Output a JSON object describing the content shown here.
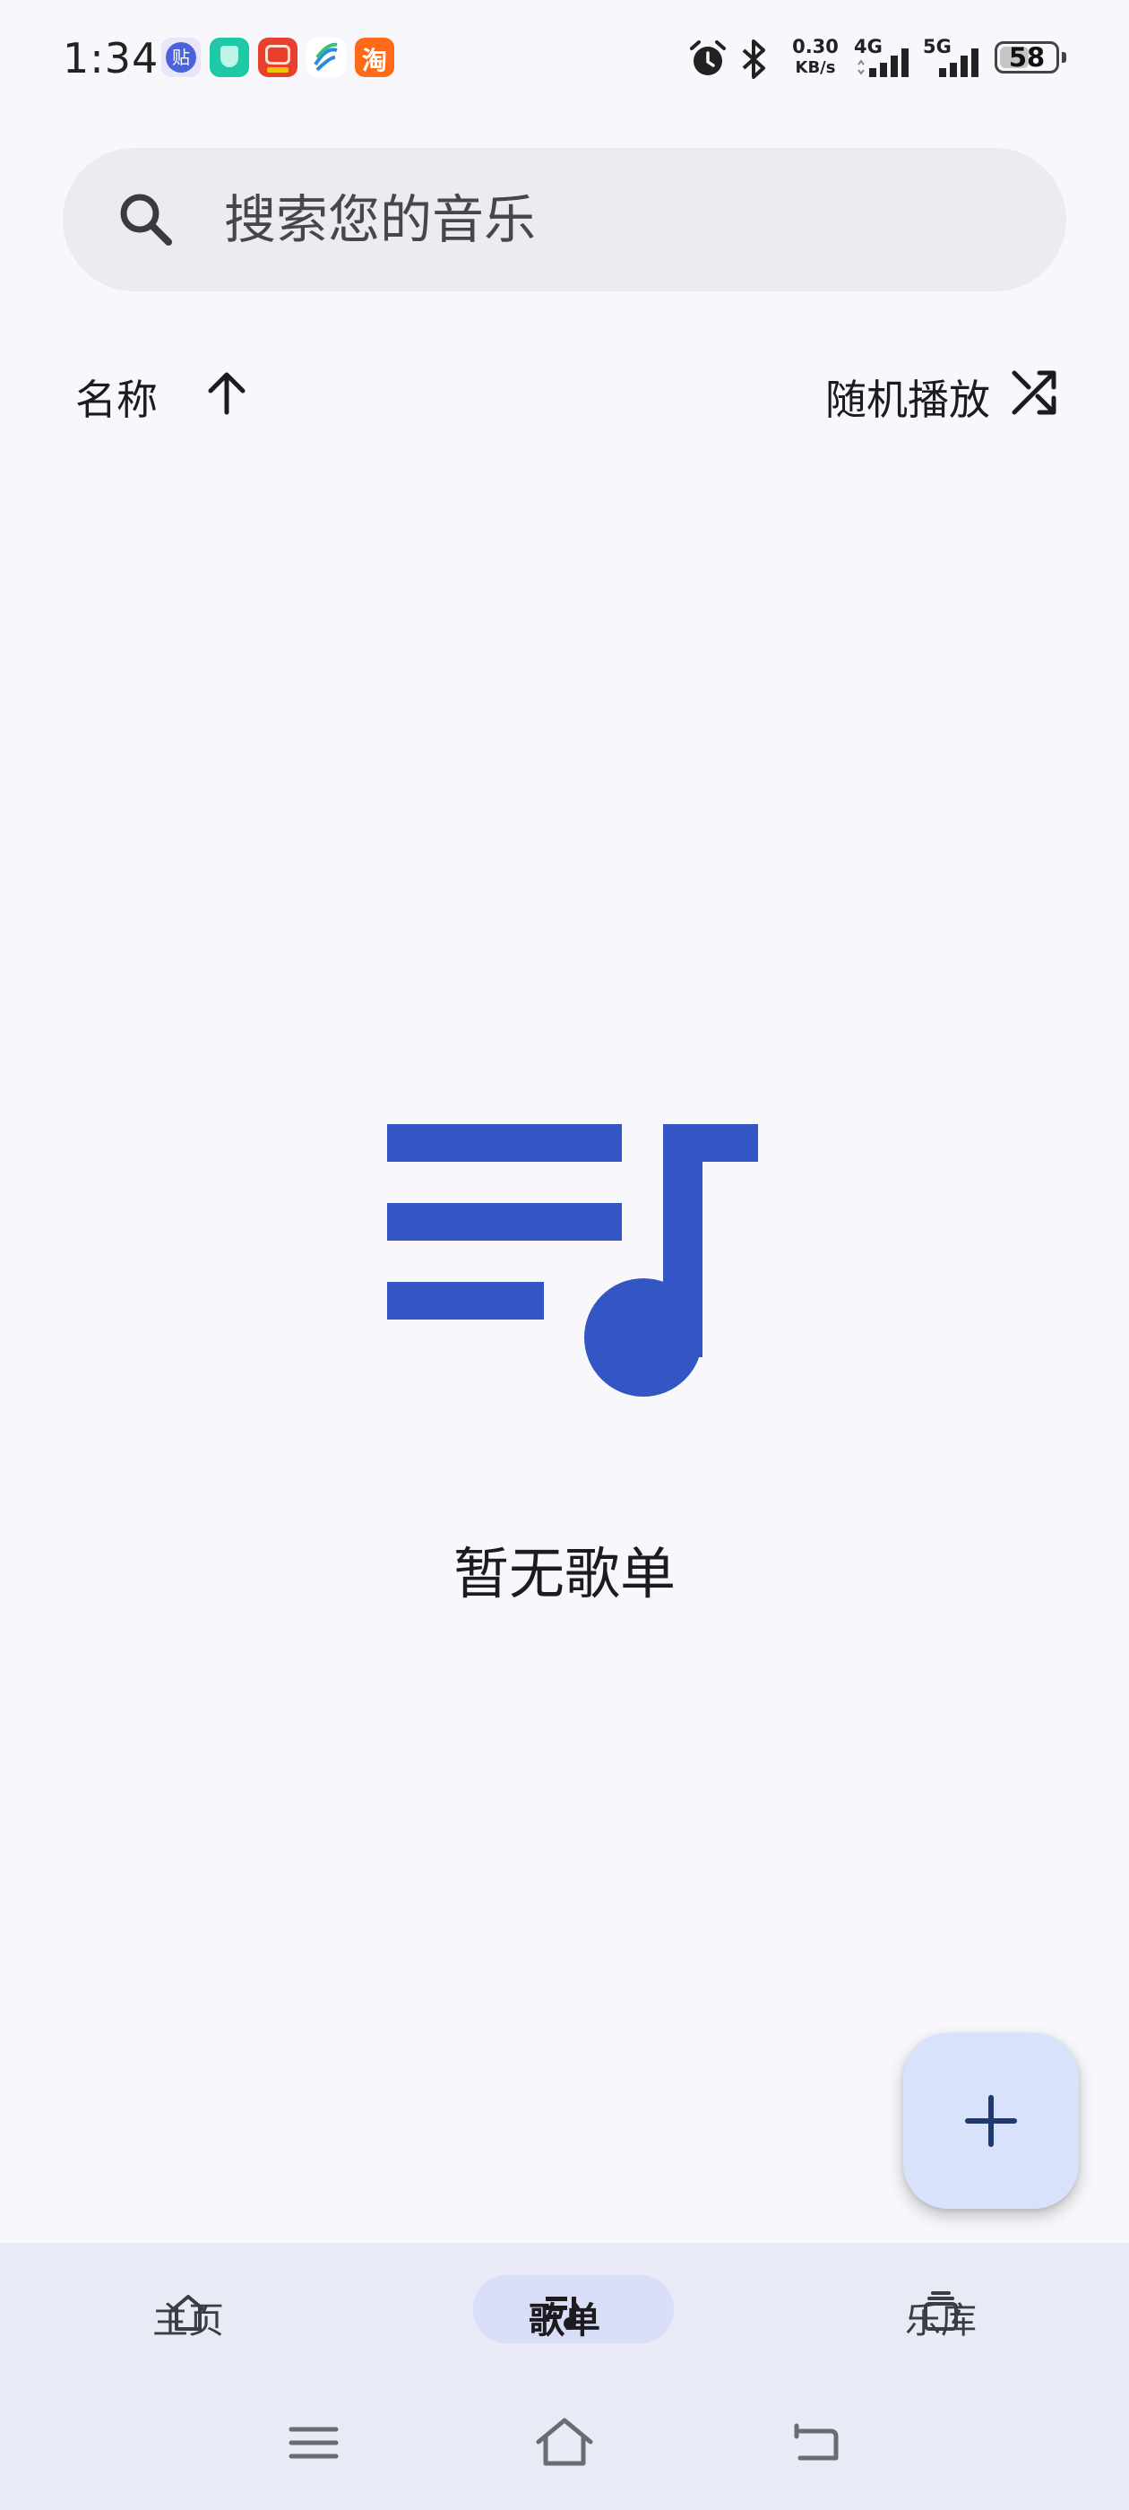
{
  "status_bar": {
    "time": "1:34",
    "notification_icons": [
      {
        "name": "tieba-app-icon",
        "color": "#4b63d8",
        "glyph": "贴"
      },
      {
        "name": "security-app-icon",
        "color": "#1ec9a8",
        "glyph": ""
      },
      {
        "name": "red-app-icon",
        "color": "#e8402d",
        "glyph": ""
      },
      {
        "name": "mobile-app-icon",
        "color": "#ffffff",
        "glyph": ""
      },
      {
        "name": "taobao-app-icon",
        "color": "#ff6a1a",
        "glyph": "淘"
      }
    ],
    "net_speed_value": "0.30",
    "net_speed_unit": "KB/s",
    "network_4g": "4G",
    "network_5g": "5G",
    "battery_level": "58"
  },
  "search": {
    "placeholder": "搜索您的音乐"
  },
  "sort": {
    "label": "名称",
    "direction": "ascending",
    "shuffle_label": "随机播放"
  },
  "empty_state": {
    "message": "暂无歌单",
    "icon": "playlist-music-icon",
    "icon_color": "#3455c4"
  },
  "fab": {
    "icon": "plus-icon",
    "color": "#d8e2fb"
  },
  "bottom_nav": {
    "items": [
      {
        "label": "主页",
        "icon": "home-icon",
        "active": false
      },
      {
        "label": "歌单",
        "icon": "playlist-icon",
        "active": true
      },
      {
        "label": "乐库",
        "icon": "library-icon",
        "active": false
      }
    ]
  },
  "system_nav": {
    "buttons": [
      "menu-icon",
      "home-icon",
      "back-icon"
    ]
  }
}
